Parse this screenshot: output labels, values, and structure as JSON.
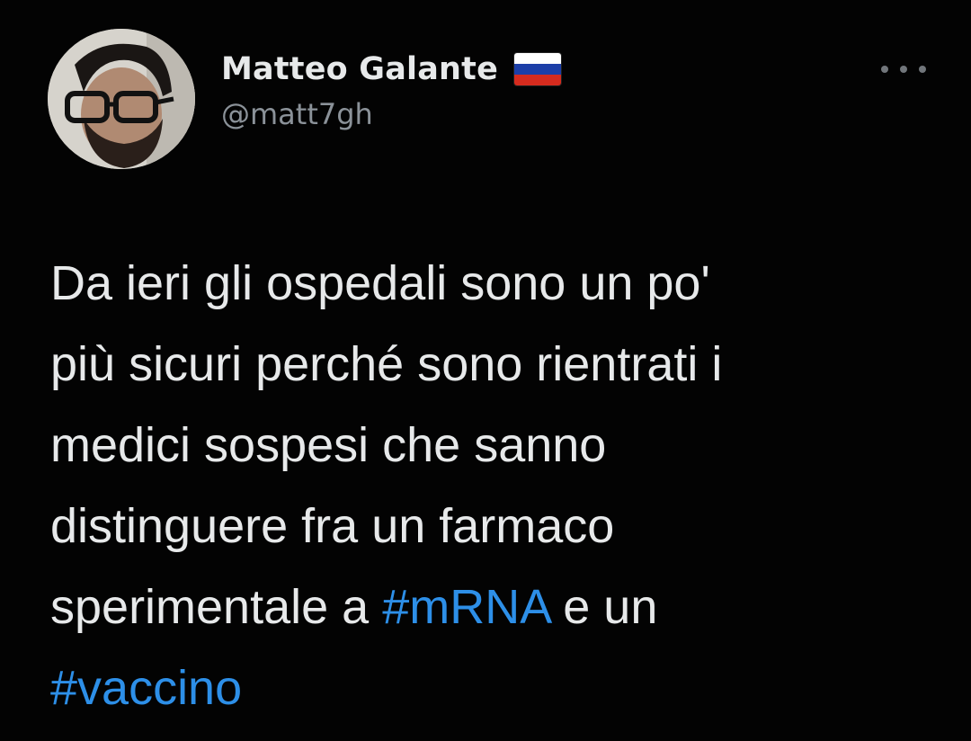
{
  "user": {
    "display_name": "Matteo Galante",
    "handle": "@matt7gh",
    "flag_icon": "russian-flag-icon",
    "flag_colors": [
      "#ffffff",
      "#1c3fa8",
      "#d52b1e"
    ]
  },
  "menu": {
    "icon": "more-options-icon"
  },
  "tweet": {
    "line1": "Da ieri gli ospedali sono un po'",
    "line2": "più sicuri perché sono rientrati i",
    "line3": "medici sospesi che sanno",
    "line4": "distinguere fra un farmaco",
    "line5_before": "sperimentale a ",
    "hashtag_mrna": "#mRNA",
    "line5_after": " e un",
    "hashtag_vaccino": "#vaccino"
  },
  "colors": {
    "background": "#030303",
    "text": "#e7e9ea",
    "secondary_text": "#8b9299",
    "hashtag": "#2d8fe8"
  }
}
